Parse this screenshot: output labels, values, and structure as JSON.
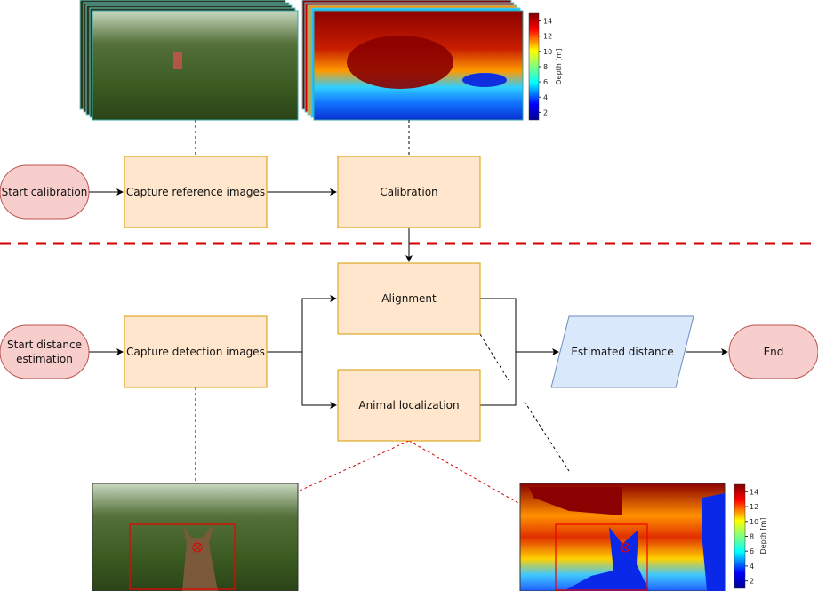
{
  "nodes": {
    "start_calibration": "Start calibration",
    "capture_reference": "Capture reference images",
    "calibration": "Calibration",
    "alignment": "Alignment",
    "start_distance_line1": "Start distance",
    "start_distance_line2": "estimation",
    "capture_detection": "Capture detection images",
    "animal_localization": "Animal localization",
    "estimated_distance": "Estimated distance",
    "end": "End"
  },
  "colorbar": {
    "label": "Depth [m]",
    "ticks": [
      "14",
      "12",
      "10",
      "8",
      "6",
      "4",
      "2"
    ]
  },
  "colors": {
    "terminal_fill": "#f8cecc",
    "terminal_stroke": "#b85450",
    "process_fill": "#ffe6cc",
    "process_stroke": "#d79b00",
    "output_fill": "#dae8fc",
    "output_stroke": "#6c8ebf",
    "separator": "#d00000"
  }
}
